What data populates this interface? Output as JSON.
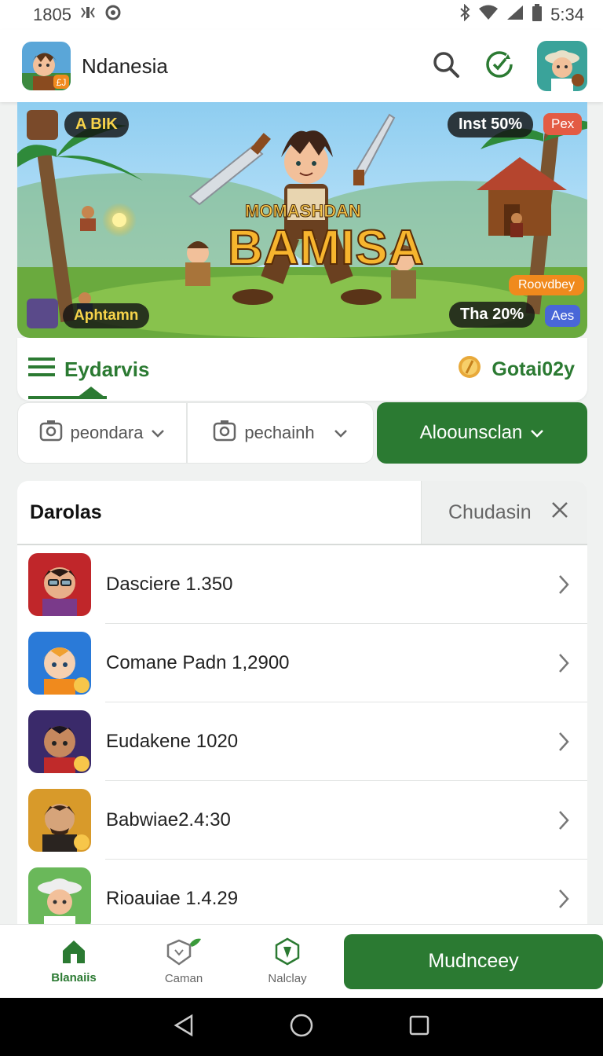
{
  "status_bar": {
    "left_time": "1805",
    "right_time": "5:34"
  },
  "app_bar": {
    "title": "Ndanesia",
    "logo_badge": "£J"
  },
  "banner": {
    "tl_label": "A BIK",
    "tr_label": "Inst",
    "tr_value": "50%",
    "tr_tag": "Pex",
    "subtitle": "MOMASHDAN",
    "title": "BAMISA",
    "bl_label": "Aphtamn",
    "br_tag_orange": "Roovdbey",
    "br_label": "Tha",
    "br_value": "20%",
    "br_tag_blue": "Aes"
  },
  "tabs": {
    "active": "Eydarvis",
    "coin_label": "Gotai02y"
  },
  "filters": [
    {
      "label": "peondara"
    },
    {
      "label": "pechainh"
    },
    {
      "label": "Aloounsclan"
    }
  ],
  "list": {
    "title": "Darolas",
    "clear_label": "Chudasin",
    "items": [
      {
        "label": "Dasciere 1.350"
      },
      {
        "label": "Comane Padn 1,2900"
      },
      {
        "label": "Eudakene 1020"
      },
      {
        "label": "Babwiae2.4:30"
      },
      {
        "label": "Rioauiae 1.4.29"
      }
    ]
  },
  "bottom_nav": {
    "items": [
      {
        "label": "Blanaiis"
      },
      {
        "label": "Caman"
      },
      {
        "label": "Nalclay"
      }
    ],
    "cta": "Mudnceey"
  },
  "colors": {
    "primary": "#2b7a32",
    "accent_yellow": "#f7b52e",
    "tag_red": "#e35b44"
  }
}
